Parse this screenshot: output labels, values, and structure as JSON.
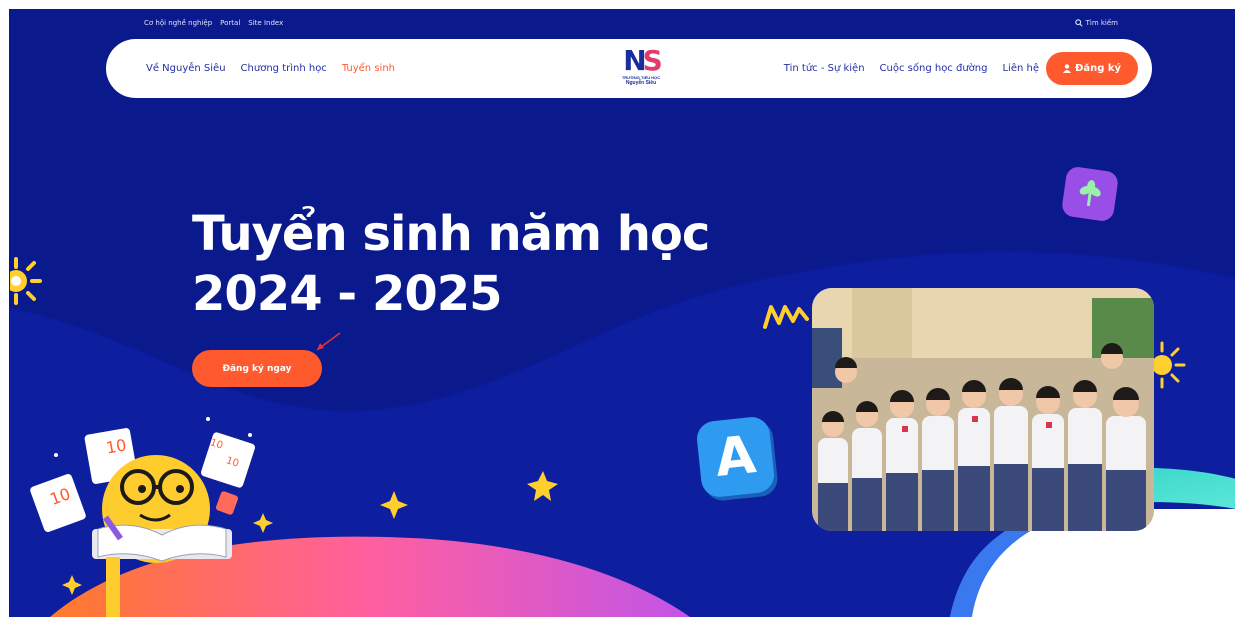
{
  "topbar": {
    "links": [
      "Cơ hội nghề nghiệp",
      "Portal",
      "Site Index"
    ],
    "search_label": "Tìm kiếm"
  },
  "nav": {
    "left_items": [
      "Về Nguyễn Siêu",
      "Chương trình học",
      "Tuyển sinh"
    ],
    "active_item": "Tuyển sinh",
    "right_items": [
      "Tin tức - Sự kiện",
      "Cuộc sống học đường",
      "Liên hệ"
    ],
    "register_label": "Đăng ký"
  },
  "logo": {
    "mark_n": "N",
    "mark_s": "S",
    "subtitle": "TRƯỜNG TIỂU HỌC",
    "name": "Nguyễn Siêu"
  },
  "hero": {
    "title_line1": "Tuyển sinh năm học",
    "title_line2": "2024 - 2025",
    "cta_label": "Đăng ký ngay"
  },
  "decor": {
    "letter_tile": "A",
    "paper_marks": [
      "10",
      "10",
      "10",
      "10"
    ]
  },
  "colors": {
    "background": "#0a1a8c",
    "accent": "#ff5a2e",
    "nav_text": "#2230a8",
    "tile_blue": "#2f9bf0",
    "tile_purple": "#9a4ee8"
  }
}
